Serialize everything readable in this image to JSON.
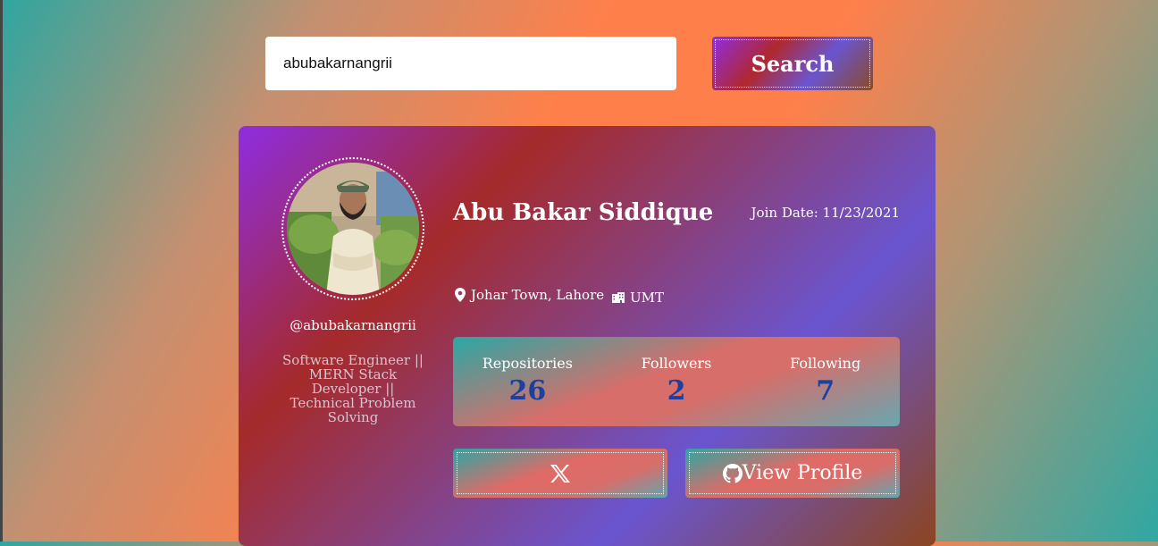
{
  "search": {
    "value": "abubakarnangrii",
    "button_label": "Search"
  },
  "profile": {
    "name": "Abu Bakar Siddique",
    "join_label": "Join Date:",
    "join_date": "11/23/2021",
    "username": "@abubakarnangrii",
    "bio": "Software Engineer || MERN Stack Developer || Technical Problem Solving",
    "location": "Johar Town, Lahore",
    "company": "UMT"
  },
  "stats": [
    {
      "label": "Repositories",
      "value": "26"
    },
    {
      "label": "Followers",
      "value": "2"
    },
    {
      "label": "Following",
      "value": "7"
    }
  ],
  "buttons": {
    "view_profile_label": "View Profile"
  },
  "icons": {
    "location": "map-pin-icon",
    "company": "building-icon",
    "twitter": "x-logo-icon",
    "github": "github-icon"
  },
  "colors": {
    "stat_value": "#1d3fa0"
  }
}
